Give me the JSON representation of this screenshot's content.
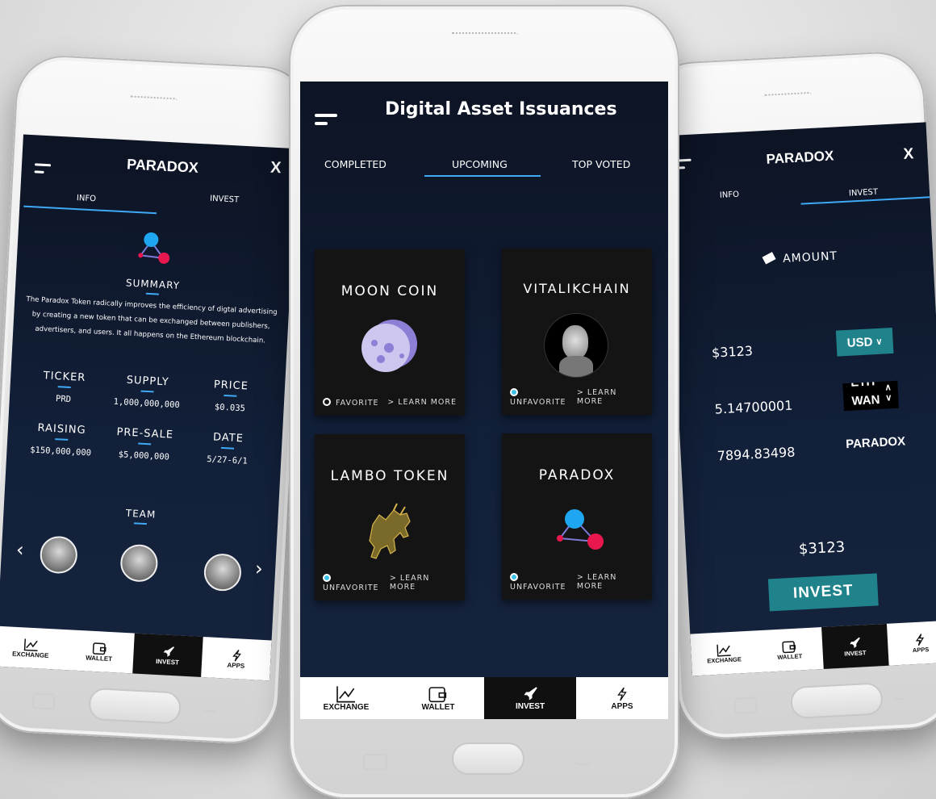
{
  "left_phone": {
    "title": "PARADOX",
    "close": "X",
    "tabs": [
      "INFO",
      "INVEST"
    ],
    "summary_heading": "SUMMARY",
    "summary_text": "The Paradox Token radically improves the efficiency of digtal advertising by creating a new token that can be exchanged between publishers, advertisers, and users. It all happens on the Ethereum blockchain.",
    "stats": [
      {
        "label": "TICKER",
        "value": "PRD"
      },
      {
        "label": "SUPPLY",
        "value": "1,000,000,000"
      },
      {
        "label": "PRICE",
        "value": "$0.035"
      },
      {
        "label": "RAISING",
        "value": "$150,000,000"
      },
      {
        "label": "PRE-SALE",
        "value": "$5,000,000"
      },
      {
        "label": "DATE",
        "value": "5/27-6/1"
      }
    ],
    "team_heading": "TEAM",
    "prev": "‹",
    "next": "›"
  },
  "center_phone": {
    "title": "Digital Asset Issuances",
    "tabs": [
      "COMPLETED",
      "UPCOMING",
      "TOP VOTED"
    ],
    "active_tab": "UPCOMING",
    "cards": [
      {
        "name": "MOON COIN",
        "favorite": "FAVORITE",
        "learn": "> LEARN MORE"
      },
      {
        "name": "VITALIKCHAIN",
        "favorite": "UNFAVORITE",
        "learn": "> LEARN MORE"
      },
      {
        "name": "LAMBO TOKEN",
        "favorite": "UNFAVORITE",
        "learn": "> LEARN MORE"
      },
      {
        "name": "PARADOX",
        "favorite": "UNFAVORITE",
        "learn": "> LEARN MORE"
      }
    ]
  },
  "right_phone": {
    "title": "PARADOX",
    "close": "X",
    "tabs": [
      "INFO",
      "INVEST"
    ],
    "amount_label": "AMOUNT",
    "usd_value": "$3123",
    "currency_select": "USD",
    "eth_value": "5.14700001",
    "eth_select_top": "ETH",
    "eth_select_bottom": "WAN",
    "token_value": "7894.83498",
    "token_name": "PARADOX",
    "total": "$3123",
    "invest_button": "INVEST"
  },
  "tabbar": [
    "EXCHANGE",
    "WALLET",
    "INVEST",
    "APPS"
  ],
  "colors": {
    "accent": "#3fa9f5",
    "invest_button": "#20838c",
    "screen_bg": "#0d1424",
    "pink": "#e8174e",
    "blue": "#1ea7f0"
  }
}
